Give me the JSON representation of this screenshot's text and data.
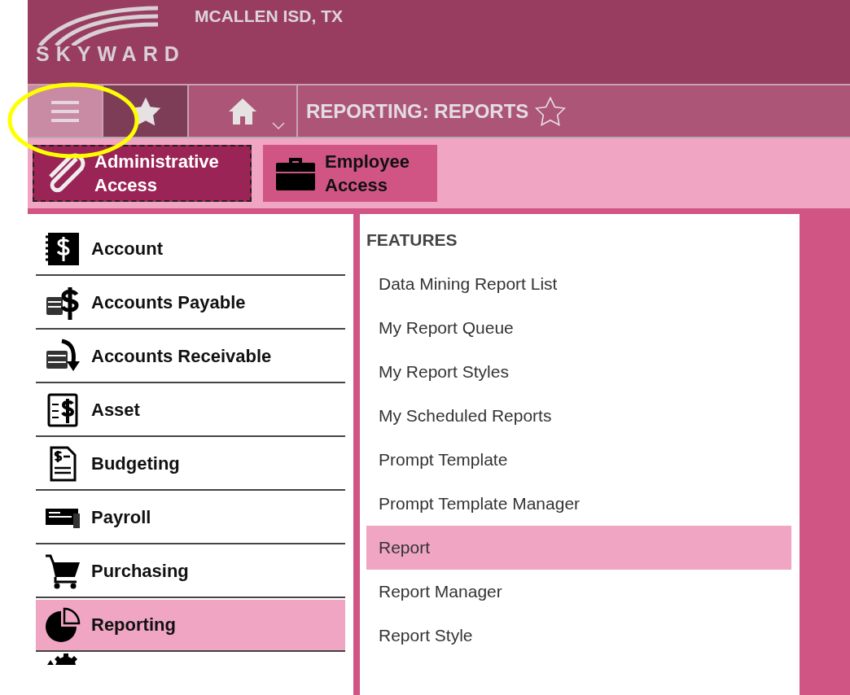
{
  "header": {
    "logo": "SKYWARD",
    "district": "MCALLEN ISD, TX"
  },
  "nav": {
    "title": "REPORTING: REPORTS"
  },
  "access": [
    {
      "label": "Administrative Access",
      "selected": true
    },
    {
      "label": "Employee Access",
      "selected": false
    }
  ],
  "sidebar": {
    "items": [
      {
        "label": "Account",
        "selected": false
      },
      {
        "label": "Accounts Payable",
        "selected": false
      },
      {
        "label": "Accounts Receivable",
        "selected": false
      },
      {
        "label": "Asset",
        "selected": false
      },
      {
        "label": "Budgeting",
        "selected": false
      },
      {
        "label": "Payroll",
        "selected": false
      },
      {
        "label": "Purchasing",
        "selected": false
      },
      {
        "label": "Reporting",
        "selected": true
      }
    ]
  },
  "features": {
    "heading": "FEATURES",
    "items": [
      {
        "label": "Data Mining Report List",
        "selected": false
      },
      {
        "label": "My Report Queue",
        "selected": false
      },
      {
        "label": "My Report Styles",
        "selected": false
      },
      {
        "label": "My Scheduled Reports",
        "selected": false
      },
      {
        "label": "Prompt Template",
        "selected": false
      },
      {
        "label": "Prompt Template Manager",
        "selected": false
      },
      {
        "label": "Report",
        "selected": true
      },
      {
        "label": "Report Manager",
        "selected": false
      },
      {
        "label": "Report Style",
        "selected": false
      }
    ]
  }
}
